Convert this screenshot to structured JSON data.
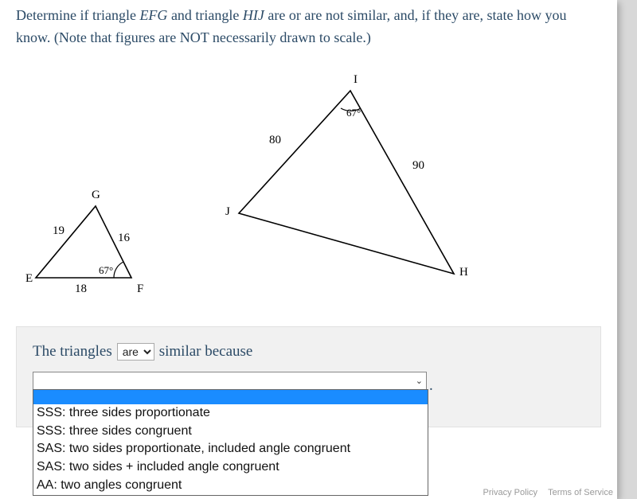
{
  "question": {
    "pre": "Determine if triangle ",
    "tri1": "EFG",
    "mid": " and triangle ",
    "tri2": "HIJ",
    "post1": " are or are not similar, and, if they are, state how you know. (Note that figures are NOT necessarily drawn to scale.)"
  },
  "triangle_efg": {
    "vertex_E": "E",
    "vertex_F": "F",
    "vertex_G": "G",
    "side_EG": "19",
    "side_GF": "16",
    "side_EF": "18",
    "angle_F": "67°"
  },
  "triangle_hij": {
    "vertex_H": "H",
    "vertex_I": "I",
    "vertex_J": "J",
    "side_IJ": "80",
    "side_IH": "90",
    "angle_I": "67°"
  },
  "answer": {
    "prefix": "The triangles",
    "select1_value": "are",
    "suffix": "similar because"
  },
  "dropdown": {
    "options": [
      "",
      "SSS: three sides proportionate",
      "SSS: three sides congruent",
      "SAS: two sides proportionate, included angle congruent",
      "SAS: two sides + included angle congruent",
      "AA: two angles congruent"
    ]
  },
  "footer": {
    "privacy": "Privacy Policy",
    "terms": "Terms of Service"
  }
}
